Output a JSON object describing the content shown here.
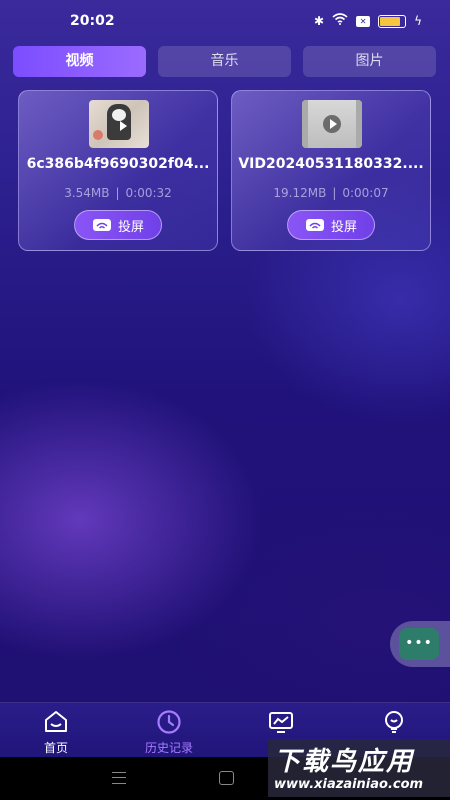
{
  "status_bar": {
    "time": "20:02",
    "icons": [
      "bluetooth-icon",
      "wifi-icon",
      "mute-icon",
      "battery-icon",
      "charging-icon"
    ],
    "mute_badge": "✕"
  },
  "tabs": [
    {
      "label": "视频",
      "active": true
    },
    {
      "label": "音乐",
      "active": false
    },
    {
      "label": "图片",
      "active": false
    }
  ],
  "videos": [
    {
      "filename": "6c386b4f9690302f04...",
      "size": "3.54MB",
      "duration": "0:00:32",
      "cast_label": "投屏"
    },
    {
      "filename": "VID20240531180332....",
      "size": "19.12MB",
      "duration": "0:00:07",
      "cast_label": "投屏"
    }
  ],
  "meta_separator": "|",
  "floating_button": {
    "label": "•••"
  },
  "bottom_nav": [
    {
      "label": "首页",
      "icon": "home-icon",
      "active": false
    },
    {
      "label": "历史记录",
      "icon": "clock-icon",
      "active": true
    },
    {
      "label": "",
      "icon": "monitor-chart-icon",
      "active": false
    },
    {
      "label": "",
      "icon": "bulb-icon",
      "active": false
    }
  ],
  "watermark": {
    "title": "下载鸟应用",
    "url": "www.xiazainiao.com"
  },
  "colors": {
    "accent": "#7c4dff",
    "active_nav": "#a77bff",
    "background": "#20127a"
  }
}
